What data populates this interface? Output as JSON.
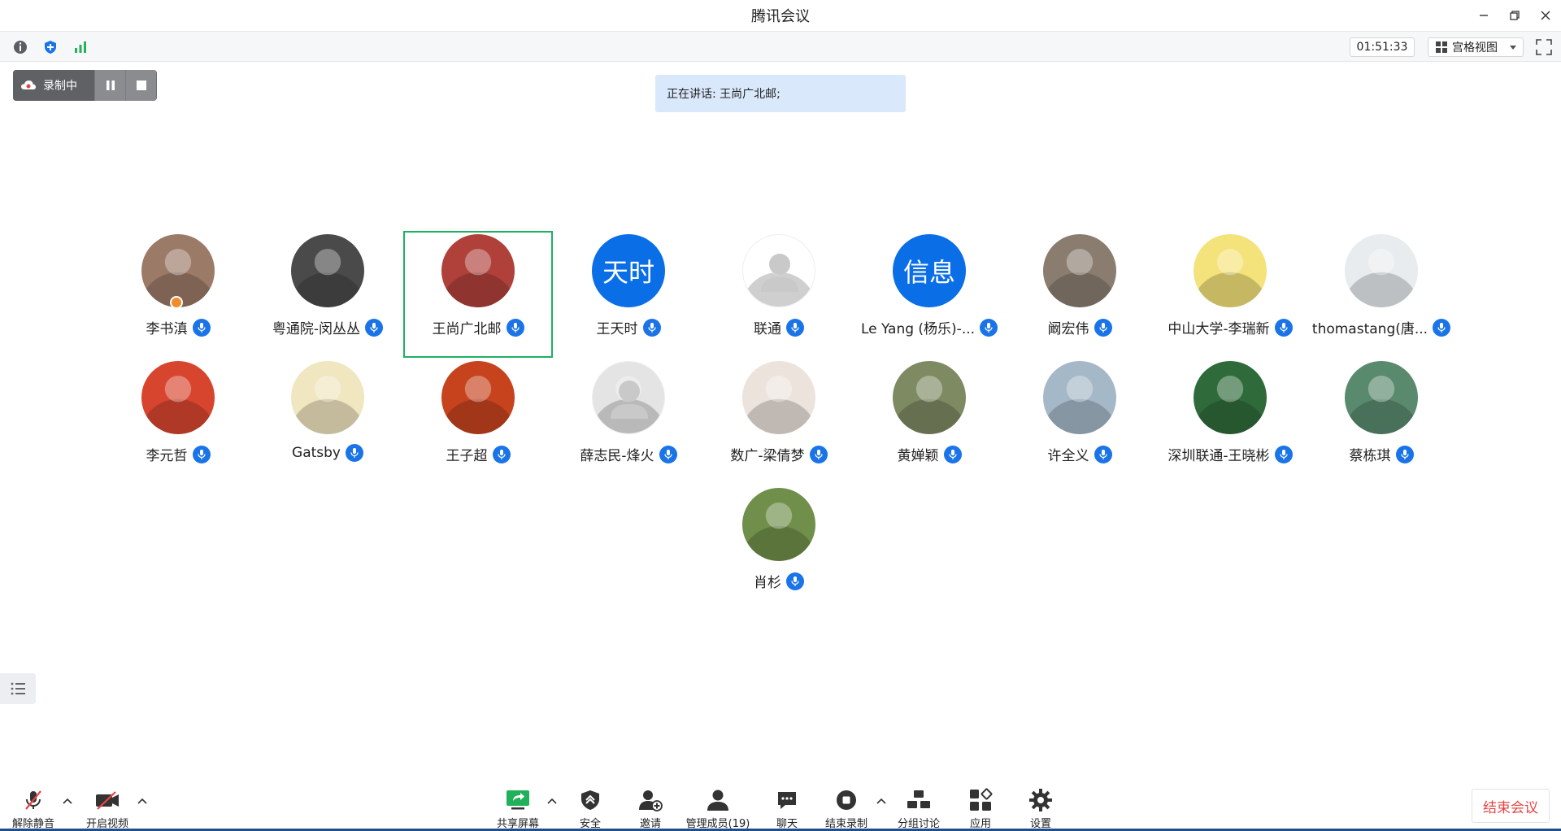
{
  "window": {
    "title": "腾讯会议"
  },
  "topbar": {
    "timer": "01:51:33",
    "view_label": "宫格视图"
  },
  "recording": {
    "label": "录制中"
  },
  "speaking": {
    "text": "正在讲话: 王尚广北邮;"
  },
  "participants": [
    {
      "name": "李书滇",
      "avatar_color": "#9b7a68",
      "host": true
    },
    {
      "name": "粤通院-闵丛丛",
      "avatar_color": "#4a4a4a"
    },
    {
      "name": "王尚广北邮",
      "avatar_color": "#b0403a",
      "active": true
    },
    {
      "name": "王天时",
      "avatar_text": "天时"
    },
    {
      "name": "联通",
      "avatar_color": "#ffffff"
    },
    {
      "name": "Le Yang (杨乐)-...",
      "avatar_text": "信息"
    },
    {
      "name": "阚宏伟",
      "avatar_color": "#8a7d70"
    },
    {
      "name": "中山大学-李瑞新",
      "avatar_color": "#f4e27a"
    },
    {
      "name": "thomastang(唐...",
      "avatar_color": "#e8ecef"
    },
    {
      "name": "李元哲",
      "avatar_color": "#d8452f"
    },
    {
      "name": "Gatsby",
      "avatar_color": "#f0e6c0"
    },
    {
      "name": "王子超",
      "avatar_color": "#c6431e"
    },
    {
      "name": "薛志民-烽火",
      "avatar_color": "#e4e4e4"
    },
    {
      "name": "数广-梁倩梦",
      "avatar_color": "#ece4dc"
    },
    {
      "name": "黄婵颖",
      "avatar_color": "#7e8a62"
    },
    {
      "name": "许全义",
      "avatar_color": "#a5b8c8"
    },
    {
      "name": "深圳联通-王晓彬",
      "avatar_color": "#2f6b3a"
    },
    {
      "name": "蔡栋琪",
      "avatar_color": "#5a8a6e"
    },
    {
      "name": "肖杉",
      "avatar_color": "#6f8f4a"
    }
  ],
  "bottombar": {
    "unmute": "解除静音",
    "video": "开启视频",
    "share": "共享屏幕",
    "security": "安全",
    "invite": "邀请",
    "members": "管理成员(19)",
    "chat": "聊天",
    "end_record": "结束录制",
    "breakout": "分组讨论",
    "apps": "应用",
    "settings": "设置",
    "end_meeting": "结束会议"
  },
  "colors": {
    "accent": "#1a74e8",
    "active_border": "#1db162",
    "end_red": "#e54545"
  }
}
